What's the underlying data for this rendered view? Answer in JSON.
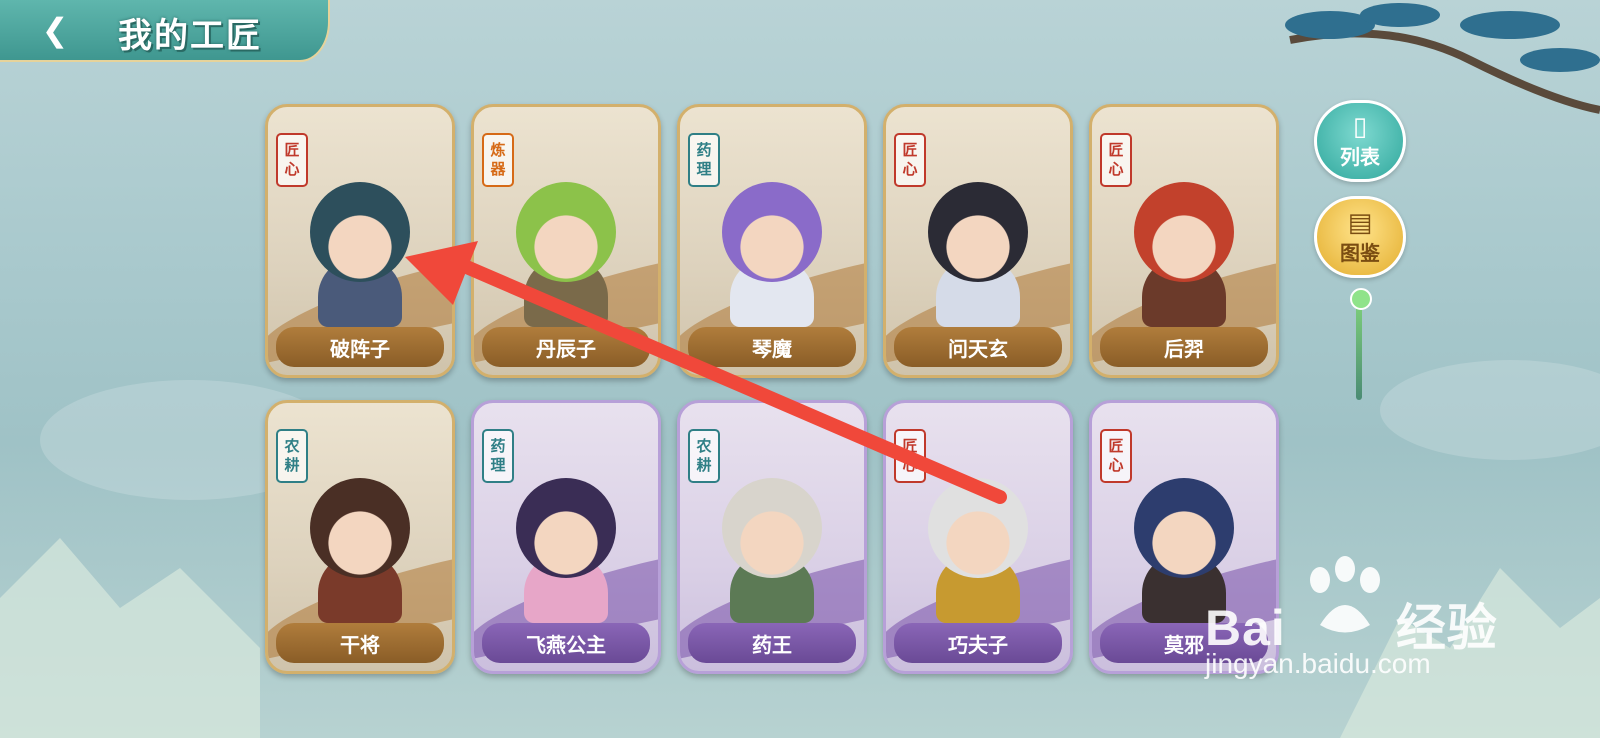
{
  "header": {
    "title": "我的工匠",
    "back_icon": "back-arrow-icon"
  },
  "side_buttons": [
    {
      "label": "列表",
      "icon": "card-list-icon"
    },
    {
      "label": "图鉴",
      "icon": "scroll-book-icon"
    }
  ],
  "cards": [
    {
      "name": "破阵子",
      "tag": [
        "匠",
        "心"
      ],
      "tag_color": "#c0392b",
      "rarity": "gold"
    },
    {
      "name": "丹辰子",
      "tag": [
        "炼",
        "器"
      ],
      "tag_color": "#d66a17",
      "rarity": "gold"
    },
    {
      "name": "琴魔",
      "tag": [
        "药",
        "理"
      ],
      "tag_color": "#2f7f86",
      "rarity": "gold"
    },
    {
      "name": "问天玄",
      "tag": [
        "匠",
        "心"
      ],
      "tag_color": "#c0392b",
      "rarity": "gold"
    },
    {
      "name": "后羿",
      "tag": [
        "匠",
        "心"
      ],
      "tag_color": "#c0392b",
      "rarity": "gold"
    },
    {
      "name": "干将",
      "tag": [
        "农",
        "耕"
      ],
      "tag_color": "#2f7f86",
      "rarity": "gold"
    },
    {
      "name": "飞燕公主",
      "tag": [
        "药",
        "理"
      ],
      "tag_color": "#2f7f86",
      "rarity": "purple"
    },
    {
      "name": "药王",
      "tag": [
        "农",
        "耕"
      ],
      "tag_color": "#2f7f86",
      "rarity": "purple"
    },
    {
      "name": "巧夫子",
      "tag": [
        "匠",
        "心"
      ],
      "tag_color": "#c0392b",
      "rarity": "purple"
    },
    {
      "name": "莫邪",
      "tag": [
        "匠",
        "心"
      ],
      "tag_color": "#c0392b",
      "rarity": "purple"
    }
  ],
  "annotation": {
    "color": "#f0483a"
  },
  "watermark": {
    "brand_left": "Bai",
    "brand_right": "经验",
    "url": "jingyan.baidu.com"
  }
}
